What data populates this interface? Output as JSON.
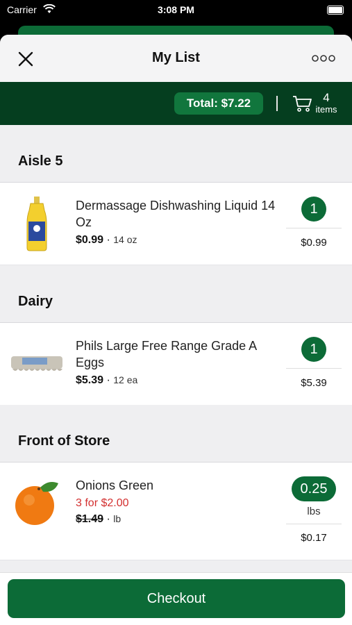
{
  "status_bar": {
    "carrier": "Carrier",
    "time": "3:08 PM"
  },
  "header": {
    "title": "My List"
  },
  "summary": {
    "total": "Total: $7.22",
    "cart_count": "4",
    "cart_label": "items"
  },
  "sections": [
    {
      "name": "Aisle 5",
      "items": [
        {
          "name": "Dermassage Dishwashing Liquid 14 Oz",
          "price": "$0.99",
          "size": "14 oz",
          "quantity": "1",
          "line_total": "$0.99"
        }
      ]
    },
    {
      "name": "Dairy",
      "items": [
        {
          "name": "Phils Large Free Range Grade A Eggs",
          "price": "$5.39",
          "size": "12 ea",
          "quantity": "1",
          "line_total": "$5.39"
        }
      ]
    },
    {
      "name": "Front of Store",
      "items": [
        {
          "name": "Onions Green",
          "sale": "3 for $2.00",
          "price": "$1.49",
          "size": "lb",
          "quantity": "0.25",
          "quantity_unit": "lbs",
          "line_total": "$0.17"
        }
      ]
    }
  ],
  "footer": {
    "checkout_label": "Checkout"
  },
  "colors": {
    "primary": "#0c6b37",
    "banner": "#053e1f",
    "sale": "#d32f2f"
  }
}
